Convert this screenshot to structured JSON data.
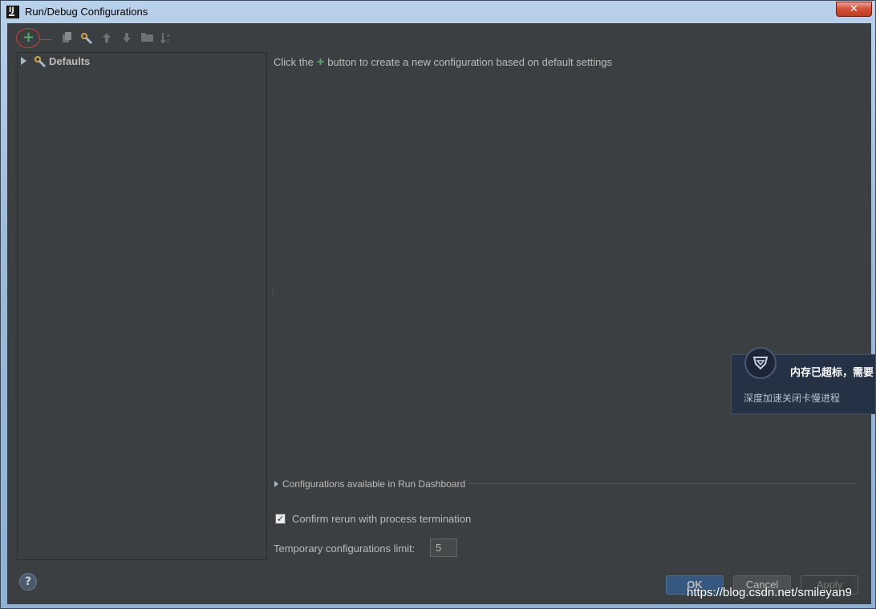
{
  "window": {
    "title": "Run/Debug Configurations",
    "close_label": "✕"
  },
  "toolbar": {
    "icons": [
      "add-icon",
      "copy-icon",
      "edit-defaults-icon",
      "move-up-icon",
      "move-down-icon",
      "folder-icon",
      "sort-icon"
    ]
  },
  "tree": {
    "items": [
      {
        "label": "Defaults",
        "icon": "defaults-wrench-icon"
      }
    ]
  },
  "main": {
    "hint_before": "Click the",
    "hint_plus": "+",
    "hint_after": "button to create a new configuration based on default settings",
    "dashboard_label": "Configurations available in Run Dashboard",
    "confirm_label": "Confirm rerun with process termination",
    "confirm_checked": true,
    "limit_label": "Temporary configurations limit:",
    "limit_value": "5"
  },
  "footer": {
    "help_label": "?",
    "ok_label": "OK",
    "cancel_label": "Cancel",
    "apply_label": "Apply"
  },
  "watermark": "https://blog.csdn.net/smileyan9",
  "popup": {
    "title": "内存已超标，需要",
    "subtitle": "深度加速关闭卡慢进程"
  },
  "colors": {
    "panel_bg": "#3c3f41",
    "accent_green": "#59a869",
    "annotation_red": "#d03a3a",
    "ok_button": "#365880"
  }
}
